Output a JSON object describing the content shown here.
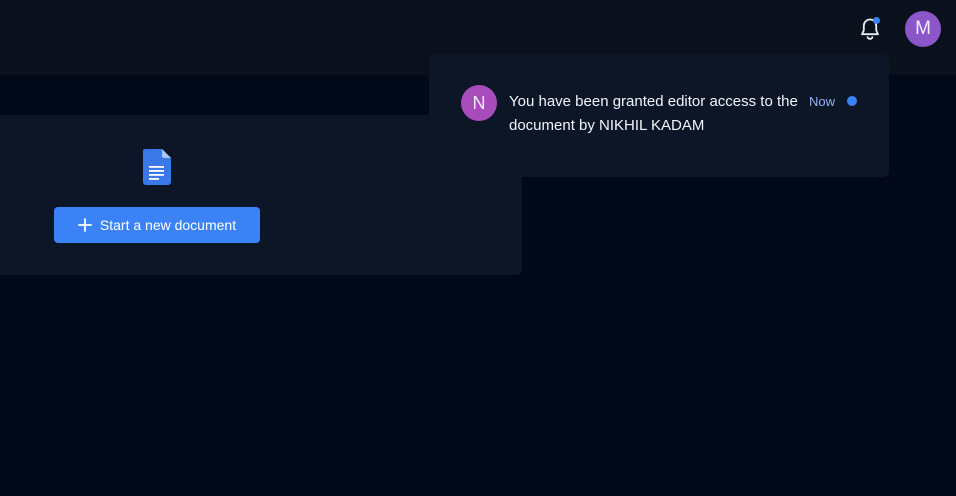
{
  "header": {
    "avatar_initial": "M",
    "notifications_unread": true
  },
  "main": {
    "new_document_button": "Start a new document",
    "doc_icon": "google-docs-icon"
  },
  "notifications": [
    {
      "avatar_initial": "N",
      "message": "You have been granted editor access to the document by NIKHIL KADAM",
      "time": "Now",
      "unread": true
    }
  ],
  "colors": {
    "background": "#010817",
    "topbar": "#0a101c",
    "card": "#0d1626",
    "accent": "#3b82f6",
    "user_avatar": "#8b56c7",
    "notif_avatar": "#a84cbc"
  }
}
